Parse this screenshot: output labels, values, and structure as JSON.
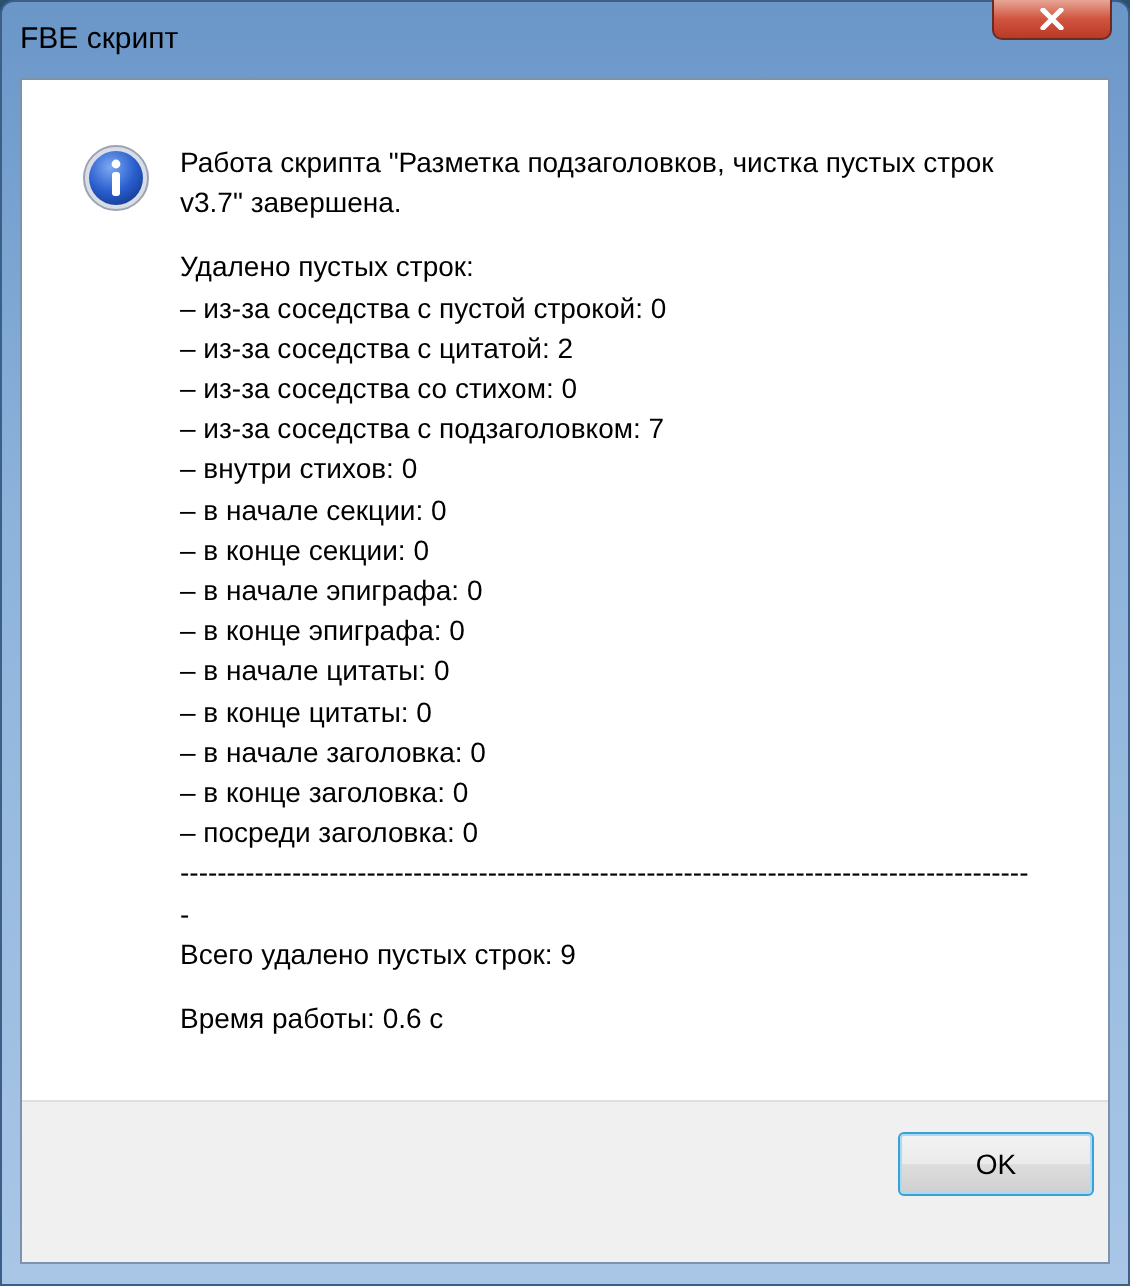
{
  "window": {
    "title": "FBE скрипт"
  },
  "message": {
    "blocks": [
      {
        "lines": [
          "Работа скрипта \"Разметка подзаголовков, чистка пустых строк v3.7\" завершена."
        ]
      },
      {
        "lines": [
          "Удалено пустых строк:",
          "– из-за соседства с пустой строкой: 0",
          "– из-за соседства с цитатой: 2",
          "– из-за соседства со стихом: 0",
          "– из-за соседства с подзаголовком: 7",
          "– внутри стихов: 0",
          "– в начале секции: 0",
          "– в конце секции: 0",
          "– в начале эпиграфа: 0",
          "– в конце эпиграфа: 0",
          "– в начале цитаты: 0",
          "– в конце цитаты: 0",
          "– в начале заголовка: 0",
          "– в конце заголовка: 0",
          "– посреди заголовка: 0",
          "--------------------------------------------------------------------------------------------",
          "Всего удалено пустых строк: 9"
        ]
      },
      {
        "lines": [
          "Время работы: 0.6 с"
        ]
      }
    ]
  },
  "buttons": [
    {
      "label": "OK",
      "default": true
    }
  ]
}
